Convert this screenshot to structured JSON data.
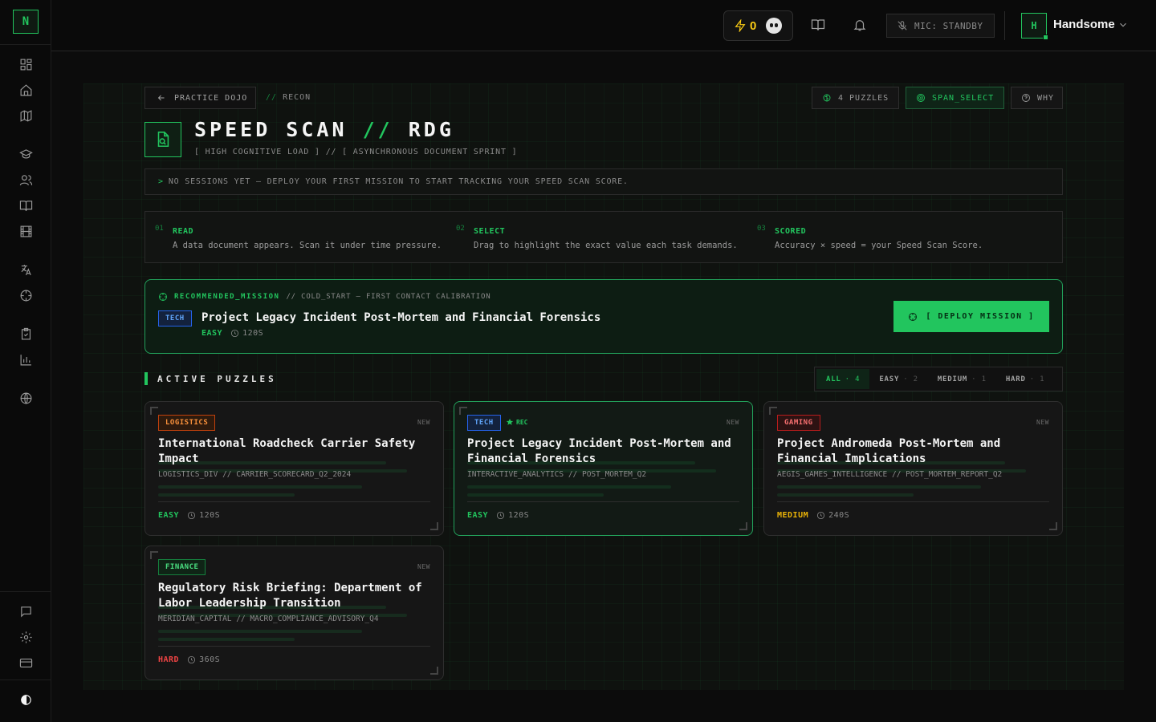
{
  "sidebar": {
    "logo": "N",
    "top_icons": [
      "dashboard-icon",
      "home-icon",
      "map-icon",
      "graduation-cap-icon",
      "users-icon",
      "book-icon",
      "film-icon",
      "translate-icon",
      "crosshair-icon",
      "clipboard-icon",
      "bar-chart-icon",
      "globe-icon"
    ],
    "bottom_icons": [
      "message-icon",
      "gear-icon",
      "credit-card-icon",
      "theme-toggle-icon"
    ]
  },
  "header": {
    "credits": "0",
    "mic_label": "MIC: STANDBY",
    "avatar_initial": "H",
    "username": "Handsome"
  },
  "page": {
    "back_label": "PRACTICE DOJO",
    "crumb_sep": "//",
    "crumb": "RECON",
    "chips": {
      "puzzles": "4 PUZZLES",
      "span_select": "SPAN_SELECT",
      "why": "WHY"
    },
    "title_main": "SPEED SCAN",
    "title_sep": "//",
    "title_code": "RDG",
    "subtitle": "[ HIGH COGNITIVE LOAD ] // [ ASYNCHRONOUS DOCUMENT SPRINT ]",
    "notice_prompt": ">",
    "notice": "NO SESSIONS YET — DEPLOY YOUR FIRST MISSION TO START TRACKING YOUR SPEED SCAN SCORE."
  },
  "steps": [
    {
      "num": "01",
      "name": "READ",
      "desc": "A data document appears. Scan it under time pressure."
    },
    {
      "num": "02",
      "name": "SELECT",
      "desc": "Drag to highlight the exact value each task demands."
    },
    {
      "num": "03",
      "name": "SCORED",
      "desc": "Accuracy × speed = your Speed Scan Score."
    }
  ],
  "recommended": {
    "label": "RECOMMENDED_MISSION",
    "context": "// COLD_START — FIRST CONTACT CALIBRATION",
    "tag": "TECH",
    "title": "Project Legacy Incident Post-Mortem and Financial Forensics",
    "difficulty": "EASY",
    "time": "120S",
    "deploy_label": "[ DEPLOY MISSION ]"
  },
  "puzzles_section": {
    "title": "ACTIVE PUZZLES",
    "filters": [
      {
        "label": "ALL",
        "count": "· 4"
      },
      {
        "label": "EASY",
        "count": "· 2"
      },
      {
        "label": "MEDIUM",
        "count": "· 1"
      },
      {
        "label": "HARD",
        "count": "· 1"
      }
    ],
    "rec_badge": "REC",
    "new_label": "NEW",
    "cards": [
      {
        "tag": "LOGISTICS",
        "title": "International Roadcheck Carrier Safety Impact",
        "source": "LOGISTICS_DIV // CARRIER_SCORECARD_Q2_2024",
        "difficulty": "EASY",
        "time": "120S"
      },
      {
        "tag": "TECH",
        "title": "Project Legacy Incident Post-Mortem and Financial Forensics",
        "source": "INTERACTIVE_ANALYTICS // POST_MORTEM_Q2",
        "difficulty": "EASY",
        "time": "120S"
      },
      {
        "tag": "GAMING",
        "title": "Project Andromeda Post-Mortem and Financial Implications",
        "source": "AEGIS_GAMES_INTELLIGENCE // POST_MORTEM_REPORT_Q2",
        "difficulty": "MEDIUM",
        "time": "240S"
      },
      {
        "tag": "FINANCE",
        "title": "Regulatory Risk Briefing: Department of Labor Leadership Transition",
        "source": "MERIDIAN_CAPITAL // MACRO_COMPLIANCE_ADVISORY_Q4",
        "difficulty": "HARD",
        "time": "360S"
      }
    ]
  },
  "colors": {
    "accent": "#22c55e",
    "easy": "#22c55e",
    "medium": "#eab308",
    "hard": "#ef4444",
    "background": "#0c0c0c"
  }
}
